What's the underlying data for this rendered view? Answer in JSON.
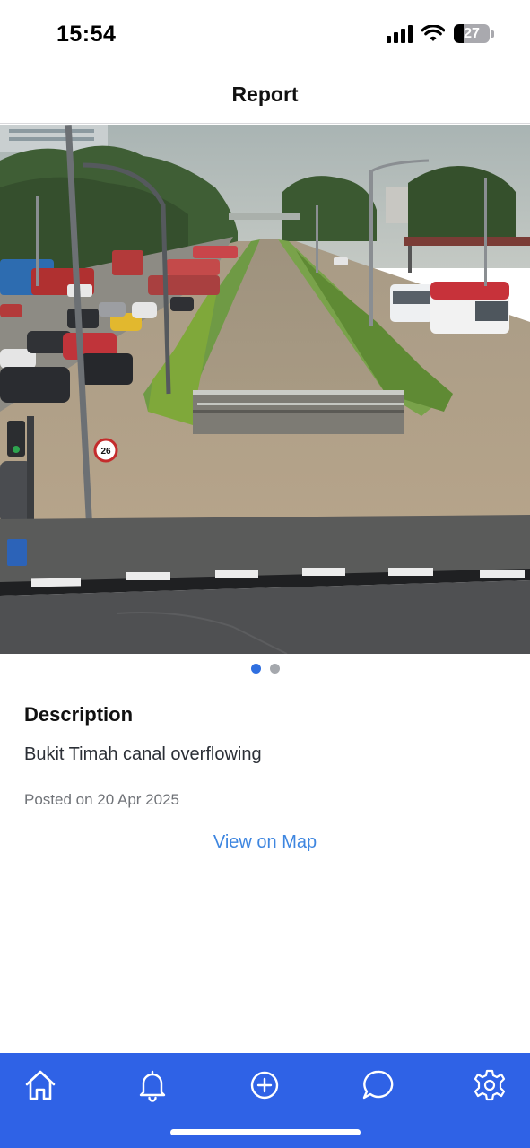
{
  "status_bar": {
    "time": "15:54",
    "battery_level": "27",
    "icons": [
      "cellular-signal-icon",
      "wifi-icon",
      "battery-icon"
    ]
  },
  "header": {
    "title": "Report"
  },
  "photo": {
    "pager_count": 2,
    "pager_active_index": 0,
    "sign_speed": "26"
  },
  "report": {
    "description_heading": "Description",
    "description": "Bukit Timah canal overflowing",
    "posted": "Posted on 20 Apr 2025",
    "view_on_map": "View on Map"
  },
  "bottom_nav": {
    "items": [
      "home-icon",
      "bell-icon",
      "plus-circle-icon",
      "chat-bubble-icon",
      "gear-icon"
    ]
  },
  "colors": {
    "accent": "#2f62e6",
    "link": "#3e86e0",
    "pager_active": "#2f6fe0",
    "pager_inactive": "#a5a8ad"
  }
}
